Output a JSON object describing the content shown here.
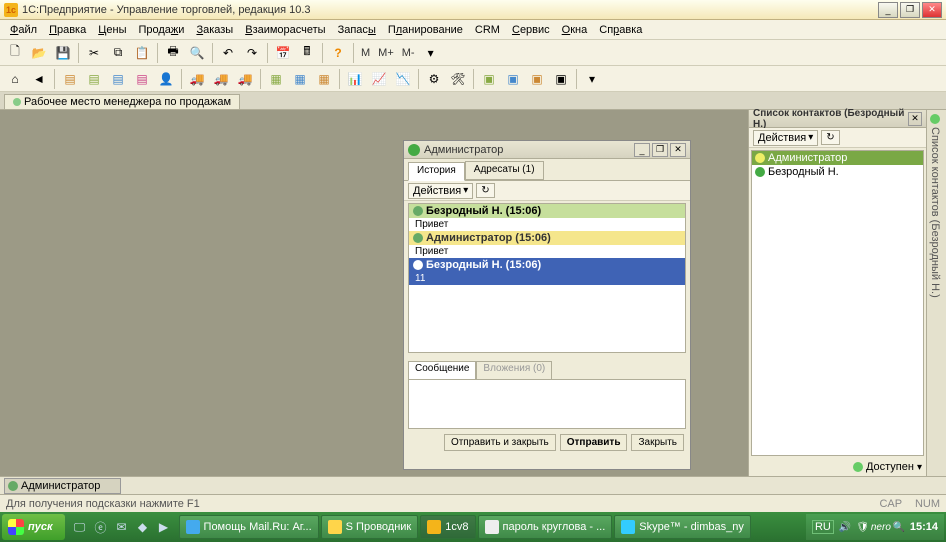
{
  "titlebar": {
    "title": "1С:Предприятие - Управление торговлей, редакция 10.3"
  },
  "menu": [
    "Файл",
    "Правка",
    "Цены",
    "Продажи",
    "Заказы",
    "Взаиморасчеты",
    "Запасы",
    "Планирование",
    "CRM",
    "Сервис",
    "Окна",
    "Справка"
  ],
  "toolbar_text": {
    "m1": "М",
    "m2": "М+",
    "m3": "М-"
  },
  "tabstrip": {
    "tab1": "Рабочее место менеджера по продажам"
  },
  "chat": {
    "title": "Администратор",
    "tabs": {
      "history": "История",
      "recipients": "Адресаты (1)"
    },
    "actions": "Действия",
    "messages": [
      {
        "hdr": "Безродный Н. (15:06)",
        "body": "Привет",
        "cls": "g1"
      },
      {
        "hdr": "Администратор (15:06)",
        "body": "Привет",
        "cls": "g2"
      },
      {
        "hdr": "Безродный Н. (15:06)",
        "body": "11",
        "cls": "g3",
        "sel": true
      }
    ],
    "compose_tabs": {
      "msg": "Сообщение",
      "attach": "Вложения (0)"
    },
    "buttons": {
      "send_close": "Отправить и закрыть",
      "send": "Отправить",
      "close": "Закрыть"
    }
  },
  "contacts": {
    "title": "Список контактов (Безродный Н.)",
    "actions": "Действия",
    "items": [
      {
        "name": "Администратор",
        "sel": true
      },
      {
        "name": "Безродный Н.",
        "sel": false
      }
    ],
    "status": "Доступен"
  },
  "vtab": "Список контактов (Безродный Н.)",
  "adminbar": {
    "tab": "Администратор"
  },
  "statusbar": {
    "hint": "Для получения подсказки нажмите F1",
    "cap": "CAP",
    "num": "NUM"
  },
  "taskbar": {
    "start": "пуск",
    "tasks": [
      "Помощь Mail.Ru: Аг...",
      "S Проводник",
      "1cv8",
      "пароль круглова - ...",
      "Skype™ - dimbas_ny"
    ],
    "lang": "RU",
    "brand": "nero",
    "clock": "15:14"
  }
}
